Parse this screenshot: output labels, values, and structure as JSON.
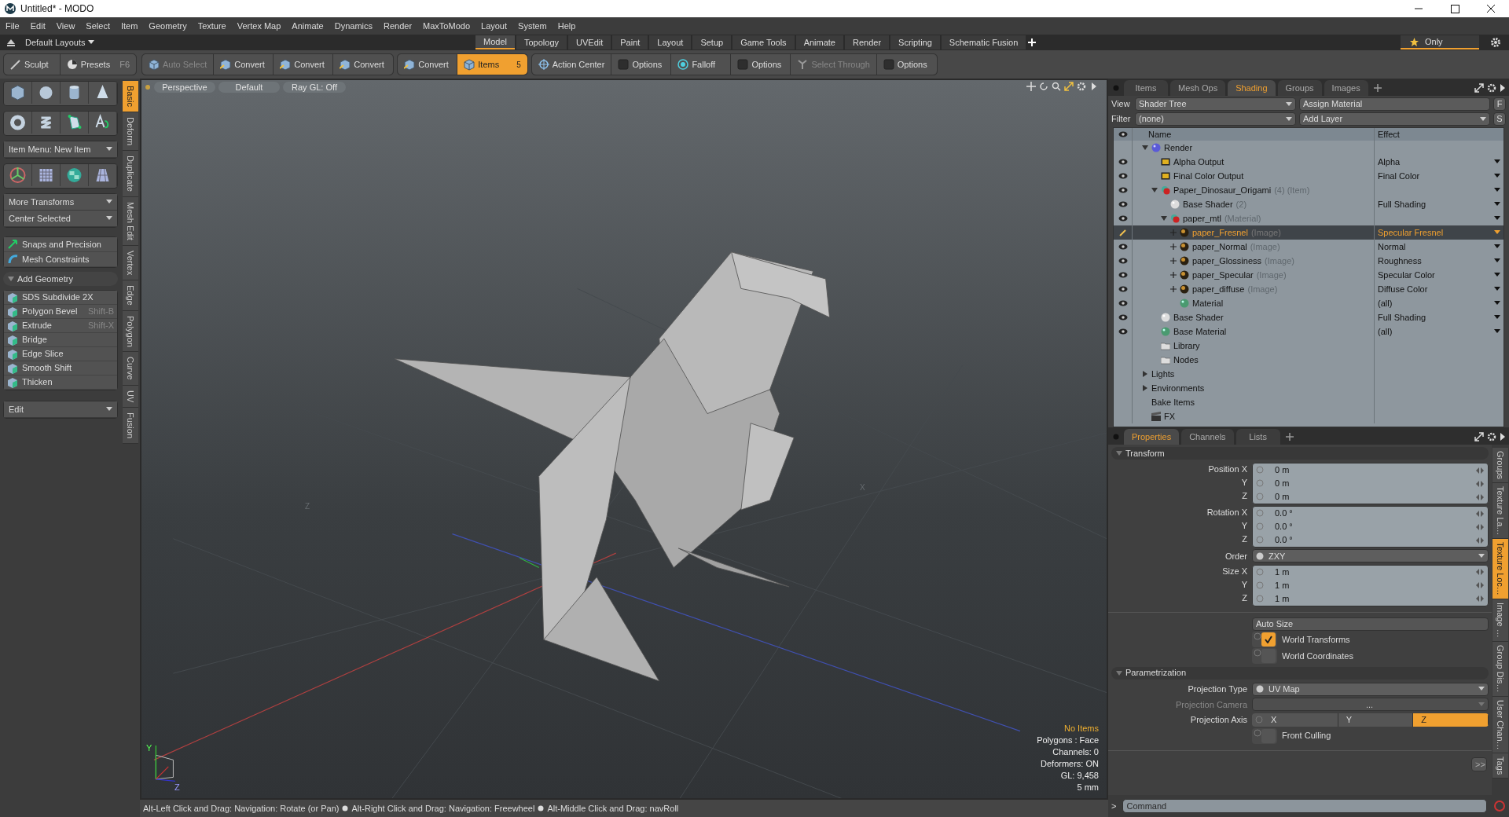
{
  "window": {
    "title": "Untitled* - MODO"
  },
  "menu": [
    "File",
    "Edit",
    "View",
    "Select",
    "Item",
    "Geometry",
    "Texture",
    "Vertex Map",
    "Animate",
    "Dynamics",
    "Render",
    "MaxToModo",
    "Layout",
    "System",
    "Help"
  ],
  "layout_bar": {
    "layouts": "Default Layouts",
    "tabs": [
      {
        "label": "Model",
        "selected": true
      },
      {
        "label": "Topology",
        "selected": false
      },
      {
        "label": "UVEdit",
        "selected": false
      },
      {
        "label": "Paint",
        "selected": false
      },
      {
        "label": "Layout",
        "selected": false
      },
      {
        "label": "Setup",
        "selected": false
      },
      {
        "label": "Game Tools",
        "selected": false
      },
      {
        "label": "Animate",
        "selected": false
      },
      {
        "label": "Render",
        "selected": false
      },
      {
        "label": "Scripting",
        "selected": false
      },
      {
        "label": "Schematic Fusion",
        "selected": false
      }
    ],
    "only": "Only"
  },
  "toolbar": {
    "sculpt": "Sculpt",
    "presets": {
      "label": "Presets",
      "shortcut": "F6"
    },
    "tool_groups": [
      [
        {
          "label": "Auto Select",
          "kind": "cube",
          "selected": false,
          "disabled": true
        },
        {
          "label": "Convert",
          "kind": "convert",
          "selected": false,
          "disabled": false
        },
        {
          "label": "Convert",
          "kind": "convert",
          "selected": false,
          "disabled": false
        },
        {
          "label": "Convert",
          "kind": "convert",
          "selected": false,
          "disabled": false
        }
      ],
      [
        {
          "label": "Convert",
          "kind": "convert",
          "selected": false,
          "disabled": false
        },
        {
          "label": "Items",
          "kind": "cube",
          "selected": true,
          "disabled": false,
          "count": "5"
        }
      ],
      [
        {
          "label": "Action Center",
          "kind": "crosshair",
          "selected": false,
          "disabled": false
        },
        {
          "label": "Options",
          "kind": "square",
          "selected": false,
          "disabled": false
        },
        {
          "label": "Falloff",
          "kind": "target",
          "selected": false,
          "disabled": false
        },
        {
          "label": "Options",
          "kind": "square",
          "selected": false,
          "disabled": false
        },
        {
          "label": "Select Through",
          "kind": "through",
          "selected": false,
          "disabled": true
        },
        {
          "label": "Options",
          "kind": "square",
          "selected": false,
          "disabled": false
        }
      ]
    ]
  },
  "left_panel": {
    "item_menu": "Item Menu: New Item",
    "transforms": [
      "More Transforms",
      "Center Selected"
    ],
    "tools": [
      "Snaps and Precision",
      "Mesh Constraints"
    ],
    "add_geometry": {
      "title": "Add Geometry",
      "expanded": true,
      "items": [
        {
          "label": "SDS Subdivide 2X"
        },
        {
          "label": "Polygon Bevel",
          "shortcut": "Shift-B"
        },
        {
          "label": "Extrude",
          "shortcut": "Shift-X"
        },
        {
          "label": "Bridge"
        },
        {
          "label": "Edge Slice"
        },
        {
          "label": "Smooth Shift"
        },
        {
          "label": "Thicken"
        }
      ]
    },
    "edit": "Edit",
    "tabs": [
      {
        "label": "Basic",
        "selected": true
      },
      {
        "label": "Deform",
        "selected": false
      },
      {
        "label": "Duplicate",
        "selected": false
      },
      {
        "label": "Mesh Edit",
        "selected": false
      },
      {
        "label": "Vertex",
        "selected": false
      },
      {
        "label": "Edge",
        "selected": false
      },
      {
        "label": "Polygon",
        "selected": false
      },
      {
        "label": "Curve",
        "selected": false
      },
      {
        "label": "UV",
        "selected": false
      },
      {
        "label": "Fusion",
        "selected": false
      }
    ]
  },
  "viewport": {
    "header": [
      "Perspective",
      "Default",
      "Ray GL: Off"
    ],
    "ground_labels": [
      "Z",
      "X"
    ],
    "gizmo_labels": [
      "Y",
      "Z"
    ],
    "info": [
      {
        "text": "No Items",
        "highlighted": true
      },
      {
        "text": "Polygons : Face",
        "highlighted": false
      },
      {
        "text": "Channels: 0",
        "highlighted": false
      },
      {
        "text": "Deformers: ON",
        "highlighted": false
      },
      {
        "text": "GL: 9,458",
        "highlighted": false
      },
      {
        "text": "5 mm",
        "highlighted": false
      }
    ]
  },
  "status_bar": {
    "hints": [
      "Alt-Left Click and Drag: Navigation: Rotate (or Pan)",
      "Alt-Right Click and Drag: Navigation: Freewheel",
      "Alt-Middle Click and Drag: navRoll"
    ]
  },
  "shading": {
    "tabs": [
      {
        "label": "Items",
        "selected": false
      },
      {
        "label": "Mesh Ops",
        "selected": false
      },
      {
        "label": "Shading",
        "selected": true
      },
      {
        "label": "Groups",
        "selected": false
      },
      {
        "label": "Images",
        "selected": false
      }
    ],
    "view_label": "View",
    "view": "Shader Tree",
    "assign": "Assign Material",
    "f_button": "F",
    "filter_label": "Filter",
    "filter": "(none)",
    "add_layer": "Add Layer",
    "s_button": "S",
    "columns": [
      "Name",
      "Effect"
    ],
    "tree": [
      {
        "name": "Render",
        "kind": "render",
        "selected": false,
        "expanded": true,
        "children": [
          {
            "name": "Alpha Output",
            "kind": "output",
            "eye": true,
            "selected": false,
            "effect": "Alpha",
            "effect_dropdown": true
          },
          {
            "name": "Final Color Output",
            "kind": "output",
            "eye": true,
            "selected": false,
            "effect": "Final Color",
            "effect_dropdown": true
          },
          {
            "name": "Paper_Dinosaur_Origami",
            "note": "(4) (Item)",
            "kind": "group",
            "eye": true,
            "selected": false,
            "expanded": true,
            "effect_dropdown": true,
            "children": [
              {
                "name": "Base Shader",
                "note": "(2)",
                "kind": "shader",
                "eye": true,
                "selected": false,
                "effect": "Full Shading",
                "effect_dropdown": true
              },
              {
                "name": "paper_mtl",
                "note": "(Material)",
                "kind": "group",
                "eye": true,
                "selected": false,
                "expanded": true,
                "effect_dropdown": true,
                "children": [
                  {
                    "name": "paper_Fresnel",
                    "note": "(Image)",
                    "kind": "image",
                    "selected": true,
                    "expanded": false,
                    "effect": "Specular Fresnel",
                    "effect_dropdown": true
                  },
                  {
                    "name": "paper_Normal",
                    "note": "(Image)",
                    "kind": "image",
                    "eye": true,
                    "selected": false,
                    "expanded": false,
                    "effect": "Normal",
                    "effect_dropdown": true
                  },
                  {
                    "name": "paper_Glossiness",
                    "note": "(Image)",
                    "kind": "image",
                    "eye": true,
                    "selected": false,
                    "expanded": false,
                    "effect": "Roughness",
                    "effect_dropdown": true
                  },
                  {
                    "name": "paper_Specular",
                    "note": "(Image)",
                    "kind": "image",
                    "eye": true,
                    "selected": false,
                    "expanded": false,
                    "effect": "Specular Color",
                    "effect_dropdown": true
                  },
                  {
                    "name": "paper_diffuse",
                    "note": "(Image)",
                    "kind": "image",
                    "eye": true,
                    "selected": false,
                    "expanded": false,
                    "effect": "Diffuse Color",
                    "effect_dropdown": true
                  },
                  {
                    "name": "Material",
                    "kind": "material",
                    "eye": true,
                    "selected": false,
                    "effect": "(all)",
                    "effect_dropdown": true
                  }
                ]
              }
            ]
          },
          {
            "name": "Base Shader",
            "kind": "shader",
            "eye": true,
            "selected": false,
            "effect": "Full Shading",
            "effect_dropdown": true
          },
          {
            "name": "Base Material",
            "kind": "material",
            "eye": true,
            "selected": false,
            "effect": "(all)",
            "effect_dropdown": true
          },
          {
            "name": "Library",
            "kind": "folder",
            "selected": false
          },
          {
            "name": "Nodes",
            "kind": "folder",
            "selected": false
          }
        ]
      },
      {
        "name": "Lights",
        "kind": "plain",
        "selected": false,
        "expanded": false
      },
      {
        "name": "Environments",
        "kind": "plain",
        "selected": false,
        "expanded": false
      },
      {
        "name": "Bake Items",
        "kind": "plain",
        "selected": false
      },
      {
        "name": "FX",
        "kind": "fx",
        "selected": false
      }
    ]
  },
  "properties": {
    "tabs": [
      {
        "label": "Properties",
        "selected": true
      },
      {
        "label": "Channels",
        "selected": false
      },
      {
        "label": "Lists",
        "selected": false
      }
    ],
    "sections": [
      {
        "title": "Transform",
        "expanded": true,
        "rows": [
          {
            "kind": "vector",
            "fields": [
              {
                "label": "Position X",
                "value": "0 m"
              },
              {
                "label": "Y",
                "value": "0 m"
              },
              {
                "label": "Z",
                "value": "0 m"
              }
            ]
          },
          {
            "kind": "vector",
            "fields": [
              {
                "label": "Rotation X",
                "value": "0.0 °"
              },
              {
                "label": "Y",
                "value": "0.0 °"
              },
              {
                "label": "Z",
                "value": "0.0 °"
              }
            ]
          },
          {
            "kind": "dropdown",
            "label": "Order",
            "value": "ZXY",
            "disabled": false
          },
          {
            "kind": "vector",
            "fields": [
              {
                "label": "Size X",
                "value": "1 m"
              },
              {
                "label": "Y",
                "value": "1 m"
              },
              {
                "label": "Z",
                "value": "1 m"
              }
            ]
          },
          {
            "kind": "button",
            "label": "Auto Size"
          },
          {
            "kind": "checkbox",
            "label": "World Transforms",
            "checked": true
          },
          {
            "kind": "checkbox",
            "label": "World Coordinates",
            "checked": false
          }
        ]
      },
      {
        "title": "Parametrization",
        "expanded": true,
        "rows": [
          {
            "kind": "dropdown",
            "label": "Projection Type",
            "value": "UV Map",
            "disabled": false
          },
          {
            "kind": "dropdown",
            "label": "Projection Camera",
            "value": "...",
            "disabled": true
          },
          {
            "kind": "segmented",
            "label": "Projection Axis",
            "options": [
              {
                "label": "X",
                "selected": false
              },
              {
                "label": "Y",
                "selected": false
              },
              {
                "label": "Z",
                "selected": true
              }
            ]
          },
          {
            "kind": "checkbox",
            "label": "Front Culling",
            "checked": false
          }
        ]
      }
    ],
    "more": ">>",
    "side_tabs": [
      {
        "label": "Groups",
        "selected": false
      },
      {
        "label": "Texture La…",
        "selected": false
      },
      {
        "label": "Texture Loc…",
        "selected": true
      },
      {
        "label": "Image …",
        "selected": false
      },
      {
        "label": "Group Dis…",
        "selected": false
      },
      {
        "label": "User Chan…",
        "selected": false
      },
      {
        "label": "Tags",
        "selected": false
      }
    ]
  },
  "command": {
    "prompt": ">",
    "placeholder": "Command"
  }
}
